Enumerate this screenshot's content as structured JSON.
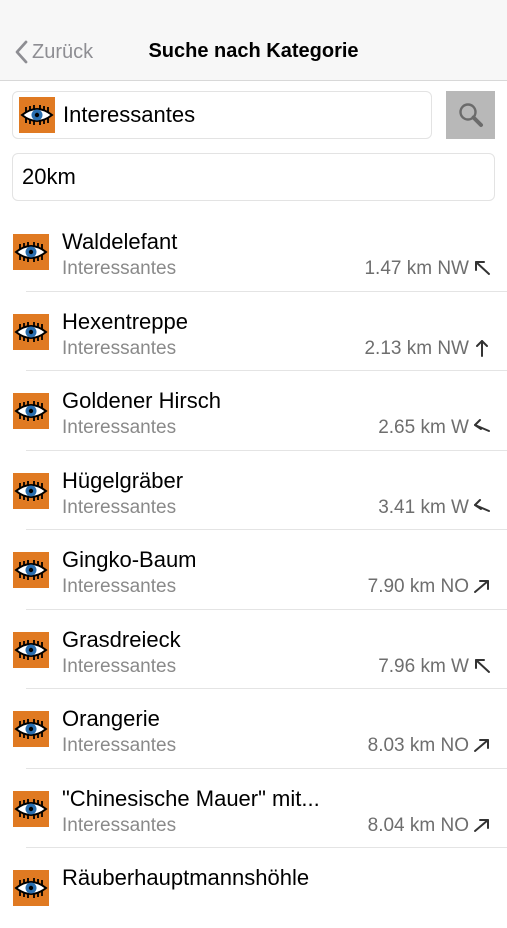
{
  "nav": {
    "back_label": "Zurück",
    "title": "Suche nach Kategorie"
  },
  "search": {
    "category": "Interessantes",
    "radius": "20km"
  },
  "colors": {
    "icon_orange": "#e07a22",
    "search_button_bg": "#b8b8b8",
    "secondary_text": "#8a8a8a"
  },
  "results": [
    {
      "name": "Waldelefant",
      "category": "Interessantes",
      "distance": "1.47 km NW",
      "direction": "NW"
    },
    {
      "name": "Hexentreppe",
      "category": "Interessantes",
      "distance": "2.13 km NW",
      "direction": "N"
    },
    {
      "name": "Goldener Hirsch",
      "category": "Interessantes",
      "distance": "2.65 km W",
      "direction": "W"
    },
    {
      "name": "Hügelgräber",
      "category": "Interessantes",
      "distance": "3.41 km W",
      "direction": "W"
    },
    {
      "name": "Gingko-Baum",
      "category": "Interessantes",
      "distance": "7.90 km NO",
      "direction": "NE"
    },
    {
      "name": "Grasdreieck",
      "category": "Interessantes",
      "distance": "7.96 km W",
      "direction": "NW"
    },
    {
      "name": "Orangerie",
      "category": "Interessantes",
      "distance": "8.03 km NO",
      "direction": "NE"
    },
    {
      "name": "\"Chinesische Mauer\" mit...",
      "category": "Interessantes",
      "distance": "8.04 km NO",
      "direction": "NE"
    },
    {
      "name": "Räuberhauptmannshöhle",
      "category": "",
      "distance": "",
      "direction": ""
    }
  ]
}
